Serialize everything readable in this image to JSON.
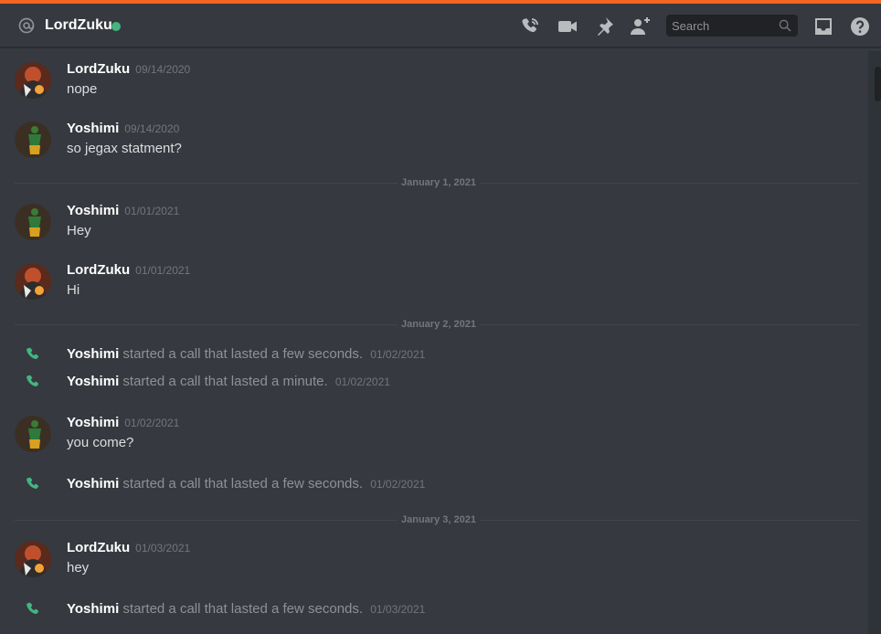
{
  "header": {
    "dm_name": "LordZuku",
    "status_color": "#43b581",
    "search_placeholder": "Search",
    "icons": [
      "at-icon",
      "start-voice-call-icon",
      "start-video-call-icon",
      "pinned-messages-icon",
      "add-friends-to-dm-icon",
      "search-icon",
      "inbox-icon",
      "help-icon"
    ]
  },
  "colors": {
    "accent": "#f26522",
    "background": "#36393f",
    "online": "#43b581",
    "call": "#43b581"
  },
  "messages": [
    {
      "author": "LordZuku",
      "timestamp": "09/14/2020",
      "text": "nope"
    },
    {
      "author": "Yoshimi",
      "timestamp": "09/14/2020",
      "text": "so jegax statment?"
    },
    {
      "divider": "January 1, 2021"
    },
    {
      "author": "Yoshimi",
      "timestamp": "01/01/2021",
      "text": "Hey"
    },
    {
      "author": "LordZuku",
      "timestamp": "01/01/2021",
      "text": "Hi"
    },
    {
      "divider": "January 2, 2021"
    },
    {
      "call_author": "Yoshimi",
      "call_text": "started a call that lasted a few seconds.",
      "timestamp": "01/02/2021"
    },
    {
      "call_author": "Yoshimi",
      "call_text": "started a call that lasted a minute.",
      "timestamp": "01/02/2021"
    },
    {
      "author": "Yoshimi",
      "timestamp": "01/02/2021",
      "text": "you come?"
    },
    {
      "call_author": "Yoshimi",
      "call_text": "started a call that lasted a few seconds.",
      "timestamp": "01/02/2021"
    },
    {
      "divider": "January 3, 2021"
    },
    {
      "author": "LordZuku",
      "timestamp": "01/03/2021",
      "text": "hey"
    },
    {
      "call_author": "Yoshimi",
      "call_text": "started a call that lasted a few seconds.",
      "timestamp": "01/03/2021"
    }
  ]
}
